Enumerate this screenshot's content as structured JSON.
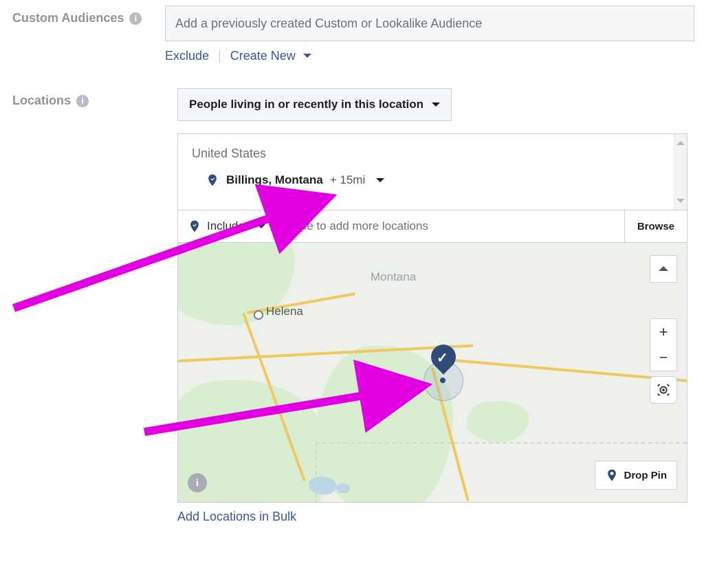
{
  "customAudiences": {
    "label": "Custom Audiences",
    "placeholder": "Add a previously created Custom or Lookalike Audience",
    "excludeLabel": "Exclude",
    "createNewLabel": "Create New"
  },
  "locations": {
    "label": "Locations",
    "filterSelected": "People living in or recently in this location",
    "country": "United States",
    "selected": {
      "city": "Billings, Montana",
      "radiusLabel": "+ 15mi"
    },
    "includeLabel": "Include",
    "typePlaceholder": "Type to add more locations",
    "browseLabel": "Browse",
    "dropPinLabel": "Drop Pin",
    "bulkLink": "Add Locations in Bulk",
    "mapLabels": {
      "stateLabel": "Montana",
      "cityLabel": "Helena"
    }
  }
}
